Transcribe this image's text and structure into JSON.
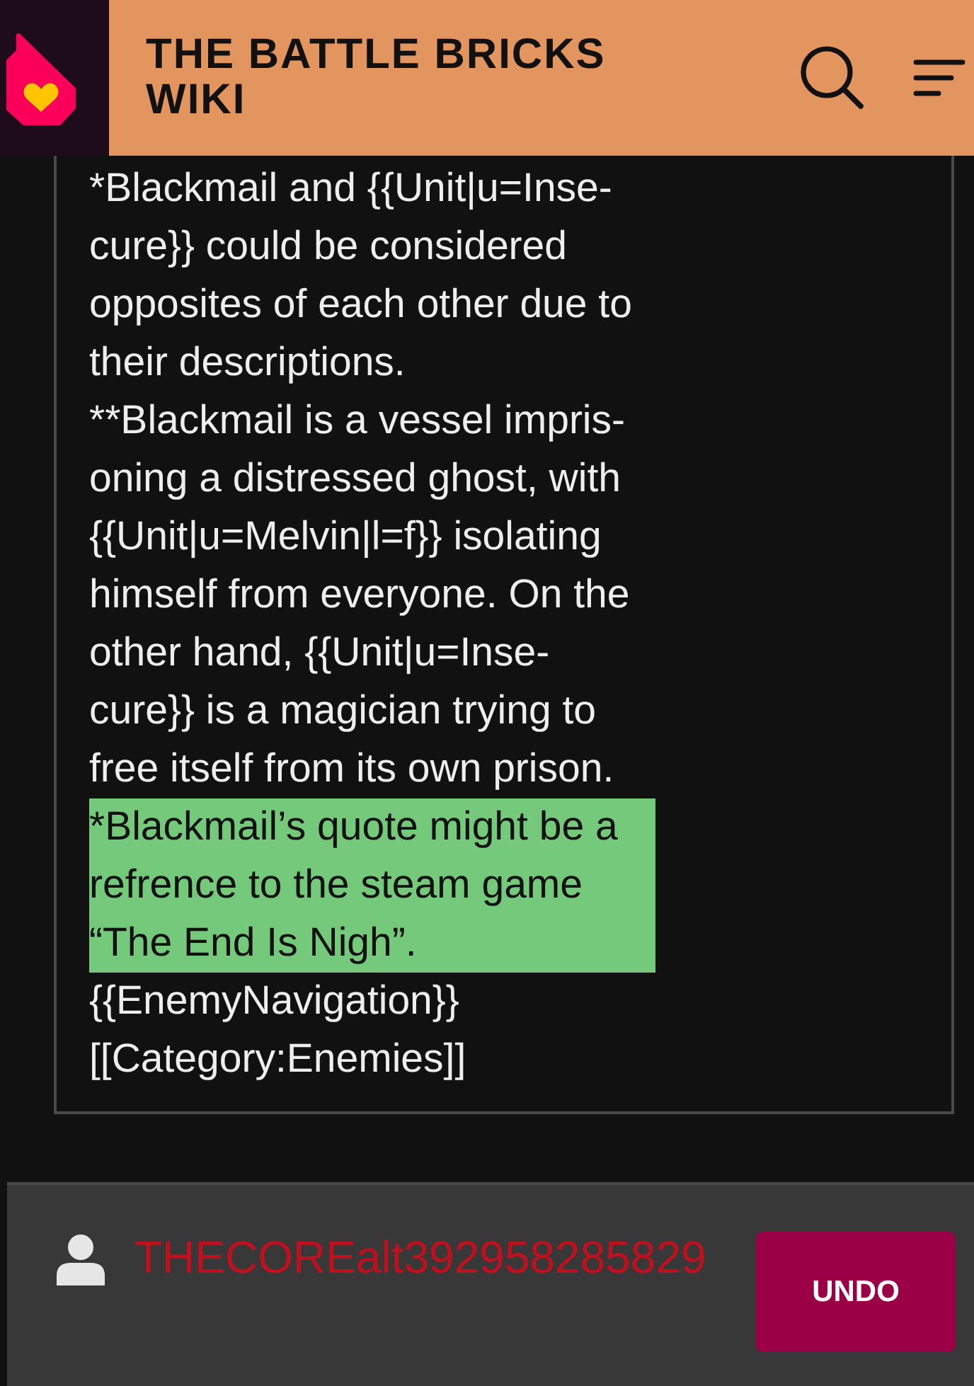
{
  "header": {
    "title": "THE BATTLE BRICKS WIKI"
  },
  "diff": {
    "paragraphs": [
      {
        "highlighted": false,
        "lines": [
          "*Blackmail and {{Unit|u=Inse-",
          "cure}} could be considered",
          "opposites of each other due to",
          "their descriptions."
        ]
      },
      {
        "highlighted": false,
        "lines": [
          "**Blackmail is a vessel impris-",
          "oning a distressed ghost, with",
          "{{Unit|u=Melvin|l=f}} isolating",
          "himself from everyone. On the",
          "other hand, {{Unit|u=Inse-",
          "cure}} is a magician trying to",
          "free itself from its own prison."
        ]
      },
      {
        "highlighted": true,
        "lines": [
          "*Blackmail’s quote might be a",
          "refrence to the steam game",
          "“The End Is Nigh”."
        ]
      },
      {
        "highlighted": false,
        "lines": [
          "{{EnemyNavigation}}"
        ]
      },
      {
        "highlighted": false,
        "lines": [
          "[[Category:Enemies]]"
        ]
      }
    ]
  },
  "footer": {
    "username": "THECOREalt392958285829",
    "button": "UNDO"
  }
}
